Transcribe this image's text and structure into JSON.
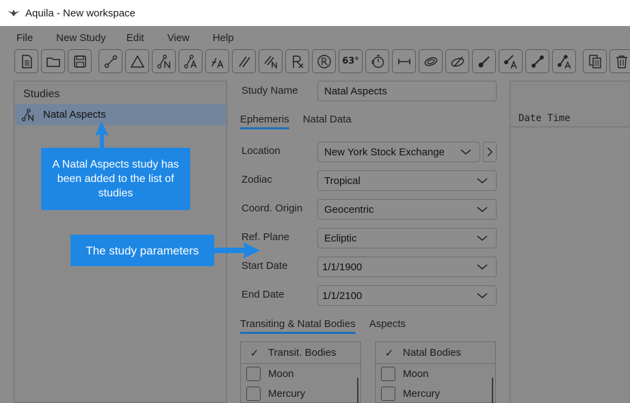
{
  "window": {
    "title": "Aquila - New workspace"
  },
  "menu": [
    "File",
    "New Study",
    "Edit",
    "View",
    "Help"
  ],
  "toolbar": {
    "text_buttons": {
      "angle": "63°"
    },
    "button_icons": [
      "new-document-icon",
      "open-folder-icon",
      "save-icon",
      "line-aspect-icon",
      "triangle-icon",
      "natal-aspect-icon",
      "aspect-a-icon",
      "angle-a-icon",
      "parallel-icon",
      "parallel-n-icon",
      "rx-icon",
      "rx-circle-icon",
      "angle-63-icon",
      "stopwatch-icon",
      "span-icon",
      "orbit-icon",
      "orbit-slash-icon",
      "stick-icon",
      "stick-a-icon",
      "bar-icon",
      "bar-a-icon",
      "copy-icon",
      "trash-icon"
    ]
  },
  "studies": {
    "header": "Studies",
    "items": [
      {
        "label": "Natal Aspects",
        "icon": "natal-aspect-icon"
      }
    ]
  },
  "callouts": {
    "studies": "A Natal Aspects study has been added to the list of studies",
    "params": "The study parameters"
  },
  "params": {
    "study_name_label": "Study Name",
    "study_name_value": "Natal Aspects",
    "tabs": [
      "Ephemeris",
      "Natal Data"
    ],
    "fields": [
      {
        "label": "Location",
        "value": "New York Stock Exchange"
      },
      {
        "label": "Zodiac",
        "value": "Tropical"
      },
      {
        "label": "Coord. Origin",
        "value": "Geocentric"
      },
      {
        "label": "Ref. Plane",
        "value": "Ecliptic"
      },
      {
        "label": "Start Date",
        "value": "1/1/1900"
      },
      {
        "label": "End Date",
        "value": "1/1/2100"
      }
    ],
    "bottom_tabs": [
      "Transiting & Natal Bodies",
      "Aspects"
    ],
    "transit_list": {
      "header": "Transit. Bodies",
      "check": "✓",
      "rows": [
        "Moon",
        "Mercury"
      ]
    },
    "natal_list": {
      "header": "Natal Bodies",
      "check": "✓",
      "rows": [
        "Moon",
        "Mercury"
      ]
    }
  },
  "results": {
    "column": "Date Time"
  },
  "colors": {
    "callout": "#1e87e4",
    "selection": "#72859c",
    "tab_underline": "#1c6fbb"
  }
}
